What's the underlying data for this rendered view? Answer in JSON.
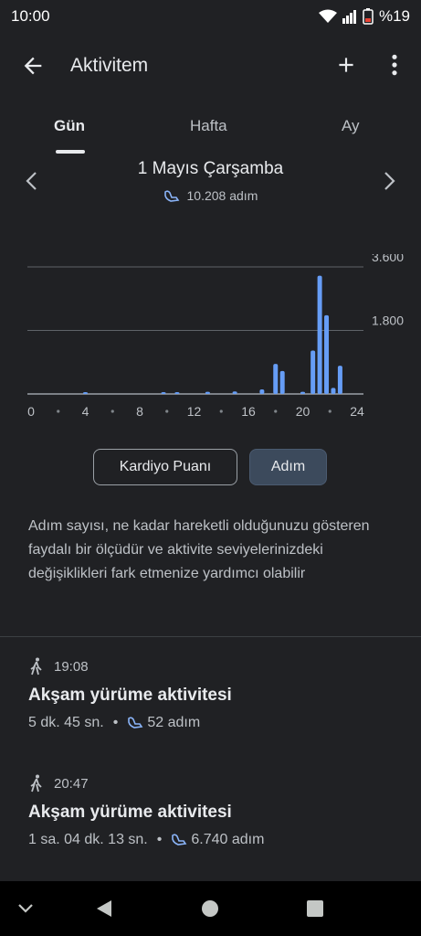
{
  "status_bar": {
    "time": "10:00",
    "battery": "%19"
  },
  "app_bar": {
    "title": "Aktivitem"
  },
  "tabs": [
    {
      "label": "Gün"
    },
    {
      "label": "Hafta"
    },
    {
      "label": "Ay"
    }
  ],
  "day": {
    "title": "1 Mayıs Çarşamba",
    "steps": "10.208 adım"
  },
  "chart_data": {
    "type": "bar",
    "x_ticks": [
      "0",
      "4",
      "8",
      "12",
      "16",
      "20",
      "24"
    ],
    "y_ticks": [
      "3.600",
      "1.800"
    ],
    "ylim": [
      0,
      3600
    ],
    "xlim": [
      0,
      24
    ],
    "grid": true,
    "bars": [
      {
        "hour": 4,
        "value": 20
      },
      {
        "hour": 9.75,
        "value": 15
      },
      {
        "hour": 10.75,
        "value": 15
      },
      {
        "hour": 13,
        "value": 60
      },
      {
        "hour": 15,
        "value": 70
      },
      {
        "hour": 17,
        "value": 130
      },
      {
        "hour": 18,
        "value": 850
      },
      {
        "hour": 18.5,
        "value": 650
      },
      {
        "hour": 20,
        "value": 60
      },
      {
        "hour": 20.75,
        "value": 1230
      },
      {
        "hour": 21.25,
        "value": 3350
      },
      {
        "hour": 21.75,
        "value": 2230
      },
      {
        "hour": 22.25,
        "value": 170
      },
      {
        "hour": 22.75,
        "value": 800
      }
    ]
  },
  "toggles": {
    "cardio": "Kardiyo Puanı",
    "steps": "Adım"
  },
  "description": "Adım sayısı, ne kadar hareketli olduğunuzu gösteren faydalı bir ölçüdür ve aktivite seviyelerinizdeki değişiklikleri fark etmenize yardımcı olabilir",
  "activities": [
    {
      "time": "19:08",
      "name": "Akşam yürüme aktivitesi",
      "duration": "5 dk. 45 sn.",
      "steps": "52 adım"
    },
    {
      "time": "20:47",
      "name": "Akşam yürüme aktivitesi",
      "duration": "1 sa. 04 dk. 13 sn.",
      "steps": "6.740 adım"
    }
  ],
  "colors": {
    "accent": "#8ab4f8",
    "bar": "#669df6",
    "background": "#202124"
  },
  "icons": [
    "back-arrow-icon",
    "add-icon",
    "more-vert-icon",
    "chevron-left-icon",
    "chevron-right-icon",
    "steps-icon",
    "walk-icon"
  ]
}
